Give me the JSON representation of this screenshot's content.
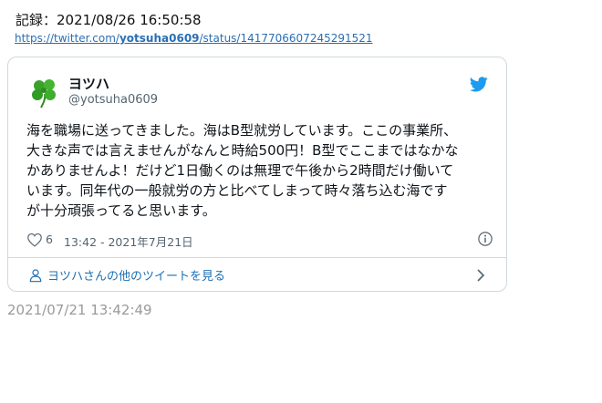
{
  "record": {
    "label": "記録：2021/08/26 16:50:58"
  },
  "source_link": {
    "prefix": "https://twitter.com/",
    "username": "yotsuha0609",
    "suffix": "/status/1417706607245291521"
  },
  "tweet": {
    "display_name": "ヨツハ",
    "handle": "@yotsuha0609",
    "text": "海を職場に送ってきました。海はB型就労しています。ここの事業所、\n大きな声では言えませんがなんと時給500円！B型でここまではなかな\nかありませんよ！だけど1日働くのは無理で午後から2時間だけ働いて\nいます。同年代の一般就労の方と比べてしまって時々落ち込む海です\nが十分頑張ってると思います。",
    "like_count": "6",
    "time": "13:42 - 2021年7月21日",
    "more_tweets_label": "ヨツハさんの他のツイートを見る"
  },
  "icons": {
    "avatar": "clover-avatar",
    "brand": "twitter-bird-icon",
    "like": "heart-icon",
    "info": "info-icon",
    "profile": "person-icon",
    "next": "chevron-right-icon"
  },
  "colors": {
    "link": "#2a6fb3",
    "twitter_blue": "#1d9bf0",
    "secondary_text": "#536471",
    "saved_timestamp": "#9a9a9a"
  },
  "saved_timestamp": "2021/07/21 13:42:49"
}
